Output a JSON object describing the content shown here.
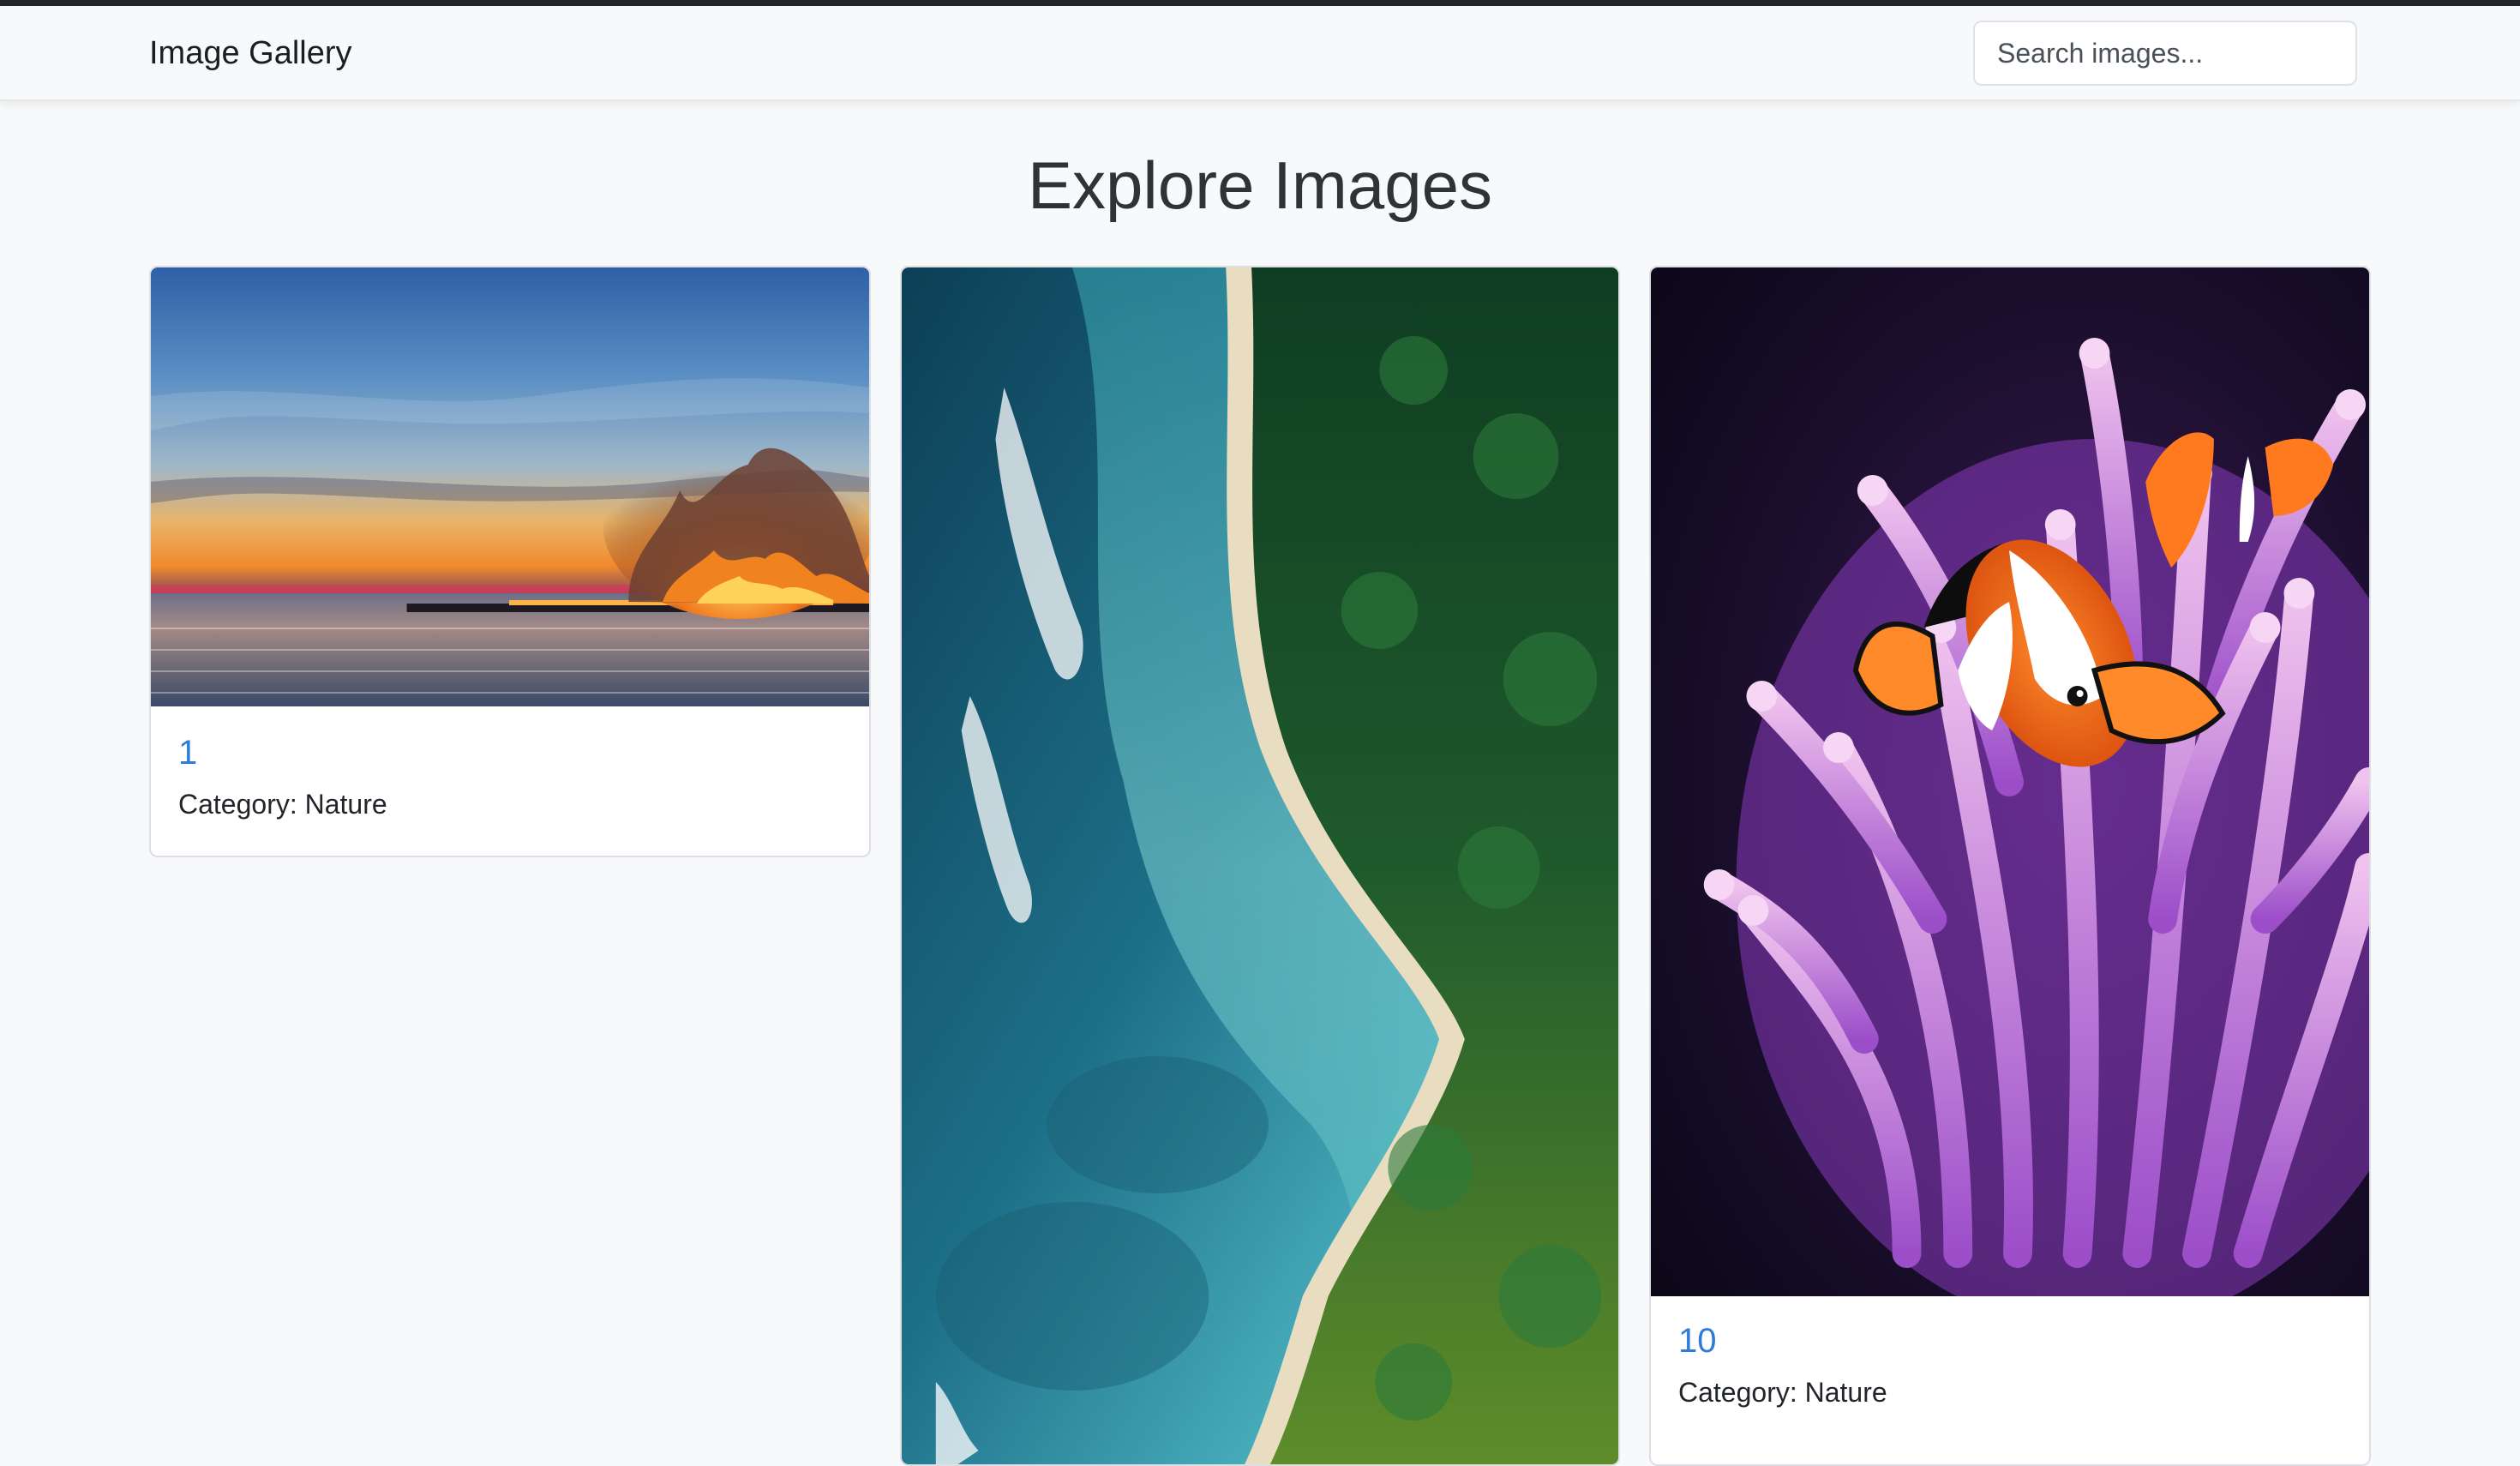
{
  "navbar": {
    "brand": "Image Gallery",
    "search_placeholder": "Search images..."
  },
  "main": {
    "title": "Explore Images",
    "cards": [
      {
        "number": "1",
        "category": "Category: Nature",
        "image_subject": "sunset over sea with wildfire smoke"
      },
      {
        "number": "",
        "category": "",
        "image_subject": "aerial view of tropical beach and palm forest"
      },
      {
        "number": "10",
        "category": "Category: Nature",
        "image_subject": "clownfish in purple sea anemone"
      }
    ]
  },
  "colors": {
    "page_background": "#f8f9fa",
    "top_strip": "#222529",
    "link_blue": "#2f7bd8",
    "card_border": "#dcdfe3"
  }
}
